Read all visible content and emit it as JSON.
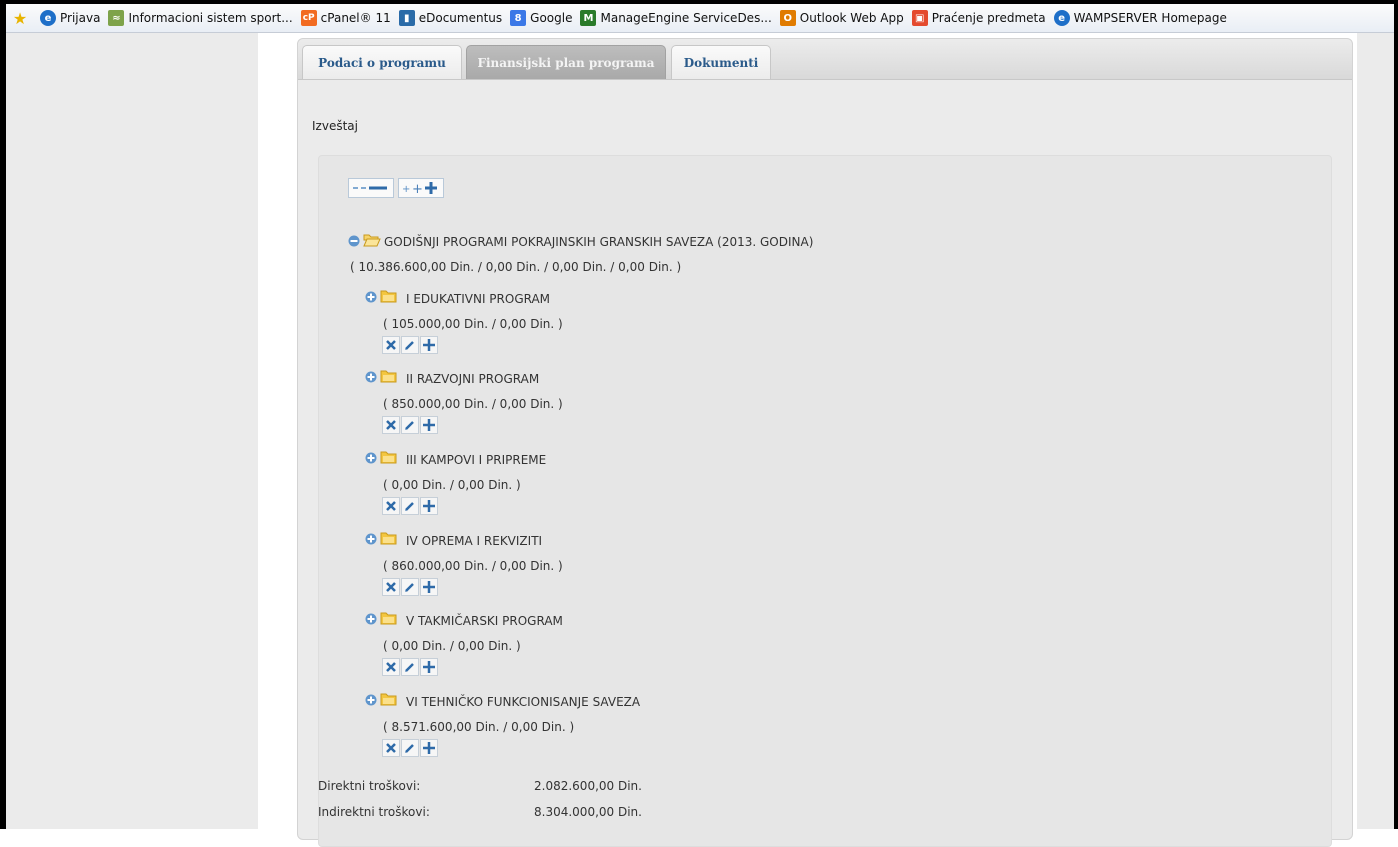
{
  "bookmarks": [
    {
      "label": "",
      "icon": "favorites-star-icon"
    },
    {
      "label": "Prijava",
      "icon": "ie-page-icon"
    },
    {
      "label": "Informacioni sistem sport...",
      "icon": "isp-icon"
    },
    {
      "label": "cPanel® 11",
      "icon": "cpanel-icon"
    },
    {
      "label": "eDocumentus",
      "icon": "edocumentus-icon"
    },
    {
      "label": "Google",
      "icon": "google-icon"
    },
    {
      "label": "ManageEngine ServiceDes...",
      "icon": "manageengine-icon"
    },
    {
      "label": "Outlook Web App",
      "icon": "outlook-icon"
    },
    {
      "label": "Praćenje predmeta",
      "icon": "pracenje-icon"
    },
    {
      "label": "WAMPSERVER Homepage",
      "icon": "ie-page-icon"
    }
  ],
  "tabs": [
    {
      "label": "Podaci o programu",
      "active": false
    },
    {
      "label": "Finansijski plan programa",
      "active": true
    },
    {
      "label": "Dokumenti",
      "active": false
    }
  ],
  "report_label": "Izveštaj",
  "toolbar": {
    "collapse_icon": "collapse-all-icon",
    "expand_icon": "expand-all-icon"
  },
  "tree": {
    "root": {
      "title": "GODIŠNJI PROGRAMI POKRAJINSKIH GRANSKIH SAVEZA (2013. GODINA)",
      "amounts": "( 10.386.600,00 Din. / 0,00 Din. / 0,00 Din. / 0,00 Din. )",
      "icon": "folder-open-icon",
      "toggle_icon": "collapse-minus-icon"
    },
    "children": [
      {
        "title": "I EDUKATIVNI PROGRAM",
        "amounts": "( 105.000,00 Din. / 0,00 Din. )"
      },
      {
        "title": "II RAZVOJNI PROGRAM",
        "amounts": "( 850.000,00 Din. / 0,00 Din. )"
      },
      {
        "title": "III KAMPOVI I PRIPREME",
        "amounts": "( 0,00 Din. / 0,00 Din. )"
      },
      {
        "title": "IV OPREMA I REKVIZITI",
        "amounts": "( 860.000,00 Din. / 0,00 Din. )"
      },
      {
        "title": "V TAKMIČARSKI PROGRAM",
        "amounts": "( 0,00 Din. / 0,00 Din. )"
      },
      {
        "title": "VI TEHNIČKO FUNKCIONISANJE SAVEZA",
        "amounts": "( 8.571.600,00 Din. / 0,00 Din. )"
      }
    ],
    "child_icons": {
      "toggle": "expand-plus-icon",
      "folder": "folder-closed-icon",
      "delete": "delete-x-icon",
      "edit": "edit-pencil-icon",
      "add": "add-plus-icon"
    }
  },
  "summary": [
    {
      "label": "Direktni troškovi:",
      "value": "2.082.600,00 Din."
    },
    {
      "label": "Indirektni troškovi:",
      "value": "8.304.000,00 Din."
    }
  ],
  "colors": {
    "tab_text": "#2a5a8a",
    "icon_blue": "#3c78b4",
    "folder_yellow": "#f2c437"
  }
}
